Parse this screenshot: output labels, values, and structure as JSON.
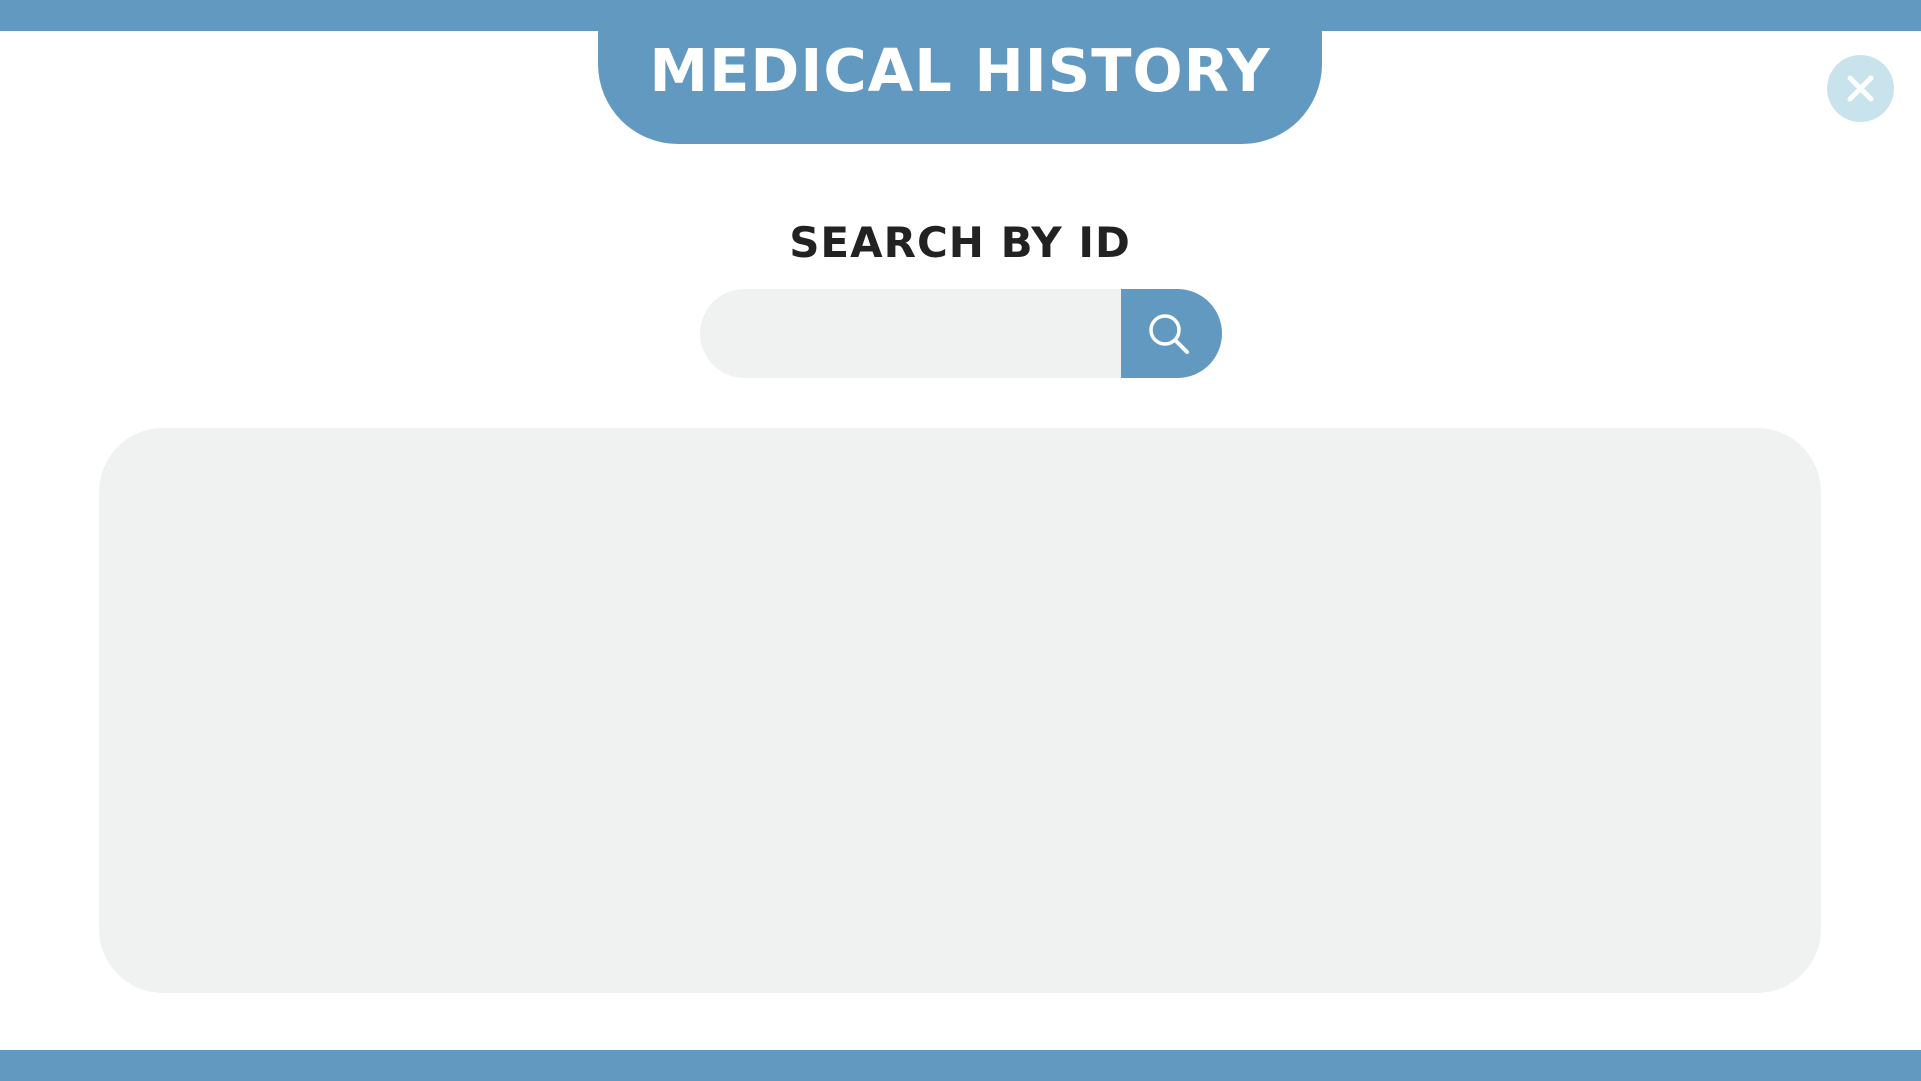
{
  "header": {
    "title": "MEDICAL HISTORY"
  },
  "search": {
    "label": "SEARCH BY ID",
    "value": "",
    "placeholder": ""
  },
  "icons": {
    "close": "close-icon",
    "search": "search-icon"
  },
  "colors": {
    "accent": "#6299c1",
    "close_button_bg": "#c9e3ec",
    "panel_bg": "#f0f1f1",
    "label_text": "#222222",
    "background": "#ffffff"
  }
}
